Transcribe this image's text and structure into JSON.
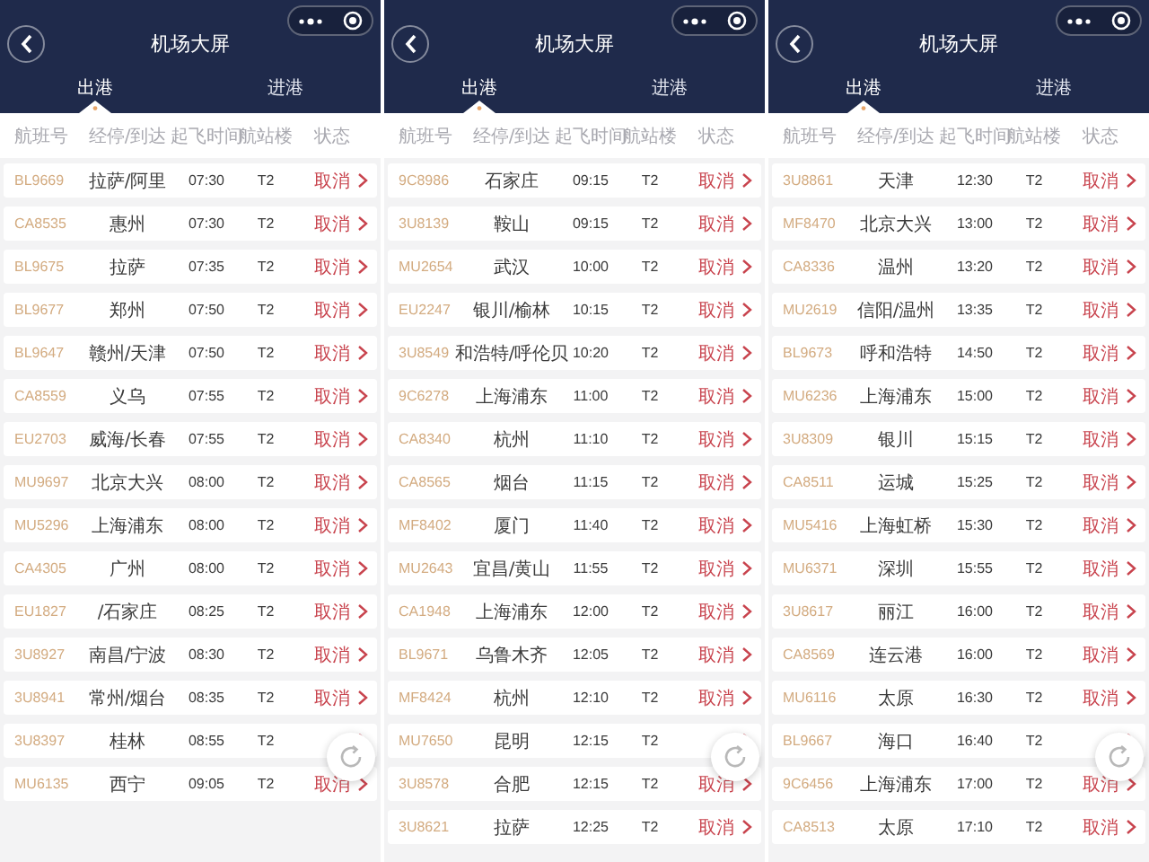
{
  "panels": [
    {
      "title": "机场大屏",
      "tabs": [
        {
          "label": "出港",
          "selected": true
        },
        {
          "label": "进港",
          "selected": false
        }
      ],
      "columns": [
        "航班号",
        "经停/到达",
        "起飞时间",
        "航站楼",
        "状态"
      ],
      "flights": [
        {
          "flight": "BL9669",
          "route": "拉萨/阿里",
          "time": "07:30",
          "terminal": "T2",
          "status": "取消"
        },
        {
          "flight": "CA8535",
          "route": "惠州",
          "time": "07:30",
          "terminal": "T2",
          "status": "取消"
        },
        {
          "flight": "BL9675",
          "route": "拉萨",
          "time": "07:35",
          "terminal": "T2",
          "status": "取消"
        },
        {
          "flight": "BL9677",
          "route": "郑州",
          "time": "07:50",
          "terminal": "T2",
          "status": "取消"
        },
        {
          "flight": "BL9647",
          "route": "赣州/天津",
          "time": "07:50",
          "terminal": "T2",
          "status": "取消"
        },
        {
          "flight": "CA8559",
          "route": "义乌",
          "time": "07:55",
          "terminal": "T2",
          "status": "取消"
        },
        {
          "flight": "EU2703",
          "route": "威海/长春",
          "time": "07:55",
          "terminal": "T2",
          "status": "取消"
        },
        {
          "flight": "MU9697",
          "route": "北京大兴",
          "time": "08:00",
          "terminal": "T2",
          "status": "取消"
        },
        {
          "flight": "MU5296",
          "route": "上海浦东",
          "time": "08:00",
          "terminal": "T2",
          "status": "取消"
        },
        {
          "flight": "CA4305",
          "route": "广州",
          "time": "08:00",
          "terminal": "T2",
          "status": "取消"
        },
        {
          "flight": "EU1827",
          "route": "/石家庄",
          "time": "08:25",
          "terminal": "T2",
          "status": "取消"
        },
        {
          "flight": "3U8927",
          "route": "南昌/宁波",
          "time": "08:30",
          "terminal": "T2",
          "status": "取消"
        },
        {
          "flight": "3U8941",
          "route": "常州/烟台",
          "time": "08:35",
          "terminal": "T2",
          "status": "取消"
        },
        {
          "flight": "3U8397",
          "route": "桂林",
          "time": "08:55",
          "terminal": "T2"
        },
        {
          "flight": "MU6135",
          "route": "西宁",
          "time": "09:05",
          "terminal": "T2",
          "status": "取消"
        }
      ]
    },
    {
      "title": "机场大屏",
      "tabs": [
        {
          "label": "出港",
          "selected": true
        },
        {
          "label": "进港",
          "selected": false
        }
      ],
      "columns": [
        "航班号",
        "经停/到达",
        "起飞时间",
        "航站楼",
        "状态"
      ],
      "flights": [
        {
          "flight": "9C8986",
          "route": "石家庄",
          "time": "09:15",
          "terminal": "T2",
          "status": "取消"
        },
        {
          "flight": "3U8139",
          "route": "鞍山",
          "time": "09:15",
          "terminal": "T2",
          "status": "取消"
        },
        {
          "flight": "MU2654",
          "route": "武汉",
          "time": "10:00",
          "terminal": "T2",
          "status": "取消"
        },
        {
          "flight": "EU2247",
          "route": "银川/榆林",
          "time": "10:15",
          "terminal": "T2",
          "status": "取消"
        },
        {
          "flight": "3U8549",
          "route": "和浩特/呼伦贝",
          "time": "10:20",
          "terminal": "T2",
          "status": "取消"
        },
        {
          "flight": "9C6278",
          "route": "上海浦东",
          "time": "11:00",
          "terminal": "T2",
          "status": "取消"
        },
        {
          "flight": "CA8340",
          "route": "杭州",
          "time": "11:10",
          "terminal": "T2",
          "status": "取消"
        },
        {
          "flight": "CA8565",
          "route": "烟台",
          "time": "11:15",
          "terminal": "T2",
          "status": "取消"
        },
        {
          "flight": "MF8402",
          "route": "厦门",
          "time": "11:40",
          "terminal": "T2",
          "status": "取消"
        },
        {
          "flight": "MU2643",
          "route": "宜昌/黄山",
          "time": "11:55",
          "terminal": "T2",
          "status": "取消"
        },
        {
          "flight": "CA1948",
          "route": "上海浦东",
          "time": "12:00",
          "terminal": "T2",
          "status": "取消"
        },
        {
          "flight": "BL9671",
          "route": "乌鲁木齐",
          "time": "12:05",
          "terminal": "T2",
          "status": "取消"
        },
        {
          "flight": "MF8424",
          "route": "杭州",
          "time": "12:10",
          "terminal": "T2",
          "status": "取消"
        },
        {
          "flight": "MU7650",
          "route": "昆明",
          "time": "12:15",
          "terminal": "T2"
        },
        {
          "flight": "3U8578",
          "route": "合肥",
          "time": "12:15",
          "terminal": "T2",
          "status": "取消"
        },
        {
          "flight": "3U8621",
          "route": "拉萨",
          "time": "12:25",
          "terminal": "T2",
          "status": "取消"
        }
      ]
    },
    {
      "title": "机场大屏",
      "tabs": [
        {
          "label": "出港",
          "selected": true
        },
        {
          "label": "进港",
          "selected": false
        }
      ],
      "columns": [
        "航班号",
        "经停/到达",
        "起飞时间",
        "航站楼",
        "状态"
      ],
      "flights": [
        {
          "flight": "3U8861",
          "route": "天津",
          "time": "12:30",
          "terminal": "T2",
          "status": "取消"
        },
        {
          "flight": "MF8470",
          "route": "北京大兴",
          "time": "13:00",
          "terminal": "T2",
          "status": "取消"
        },
        {
          "flight": "CA8336",
          "route": "温州",
          "time": "13:20",
          "terminal": "T2",
          "status": "取消"
        },
        {
          "flight": "MU2619",
          "route": "信阳/温州",
          "time": "13:35",
          "terminal": "T2",
          "status": "取消"
        },
        {
          "flight": "BL9673",
          "route": "呼和浩特",
          "time": "14:50",
          "terminal": "T2",
          "status": "取消"
        },
        {
          "flight": "MU6236",
          "route": "上海浦东",
          "time": "15:00",
          "terminal": "T2",
          "status": "取消"
        },
        {
          "flight": "3U8309",
          "route": "银川",
          "time": "15:15",
          "terminal": "T2",
          "status": "取消"
        },
        {
          "flight": "CA8511",
          "route": "运城",
          "time": "15:25",
          "terminal": "T2",
          "status": "取消"
        },
        {
          "flight": "MU5416",
          "route": "上海虹桥",
          "time": "15:30",
          "terminal": "T2",
          "status": "取消"
        },
        {
          "flight": "MU6371",
          "route": "深圳",
          "time": "15:55",
          "terminal": "T2",
          "status": "取消"
        },
        {
          "flight": "3U8617",
          "route": "丽江",
          "time": "16:00",
          "terminal": "T2",
          "status": "取消"
        },
        {
          "flight": "CA8569",
          "route": "连云港",
          "time": "16:00",
          "terminal": "T2",
          "status": "取消"
        },
        {
          "flight": "MU6116",
          "route": "太原",
          "time": "16:30",
          "terminal": "T2",
          "status": "取消"
        },
        {
          "flight": "BL9667",
          "route": "海口",
          "time": "16:40",
          "terminal": "T2"
        },
        {
          "flight": "9C6456",
          "route": "上海浦东",
          "time": "17:00",
          "terminal": "T2",
          "status": "取消"
        },
        {
          "flight": "CA8513",
          "route": "太原",
          "time": "17:10",
          "terminal": "T2",
          "status": "取消"
        }
      ]
    }
  ]
}
